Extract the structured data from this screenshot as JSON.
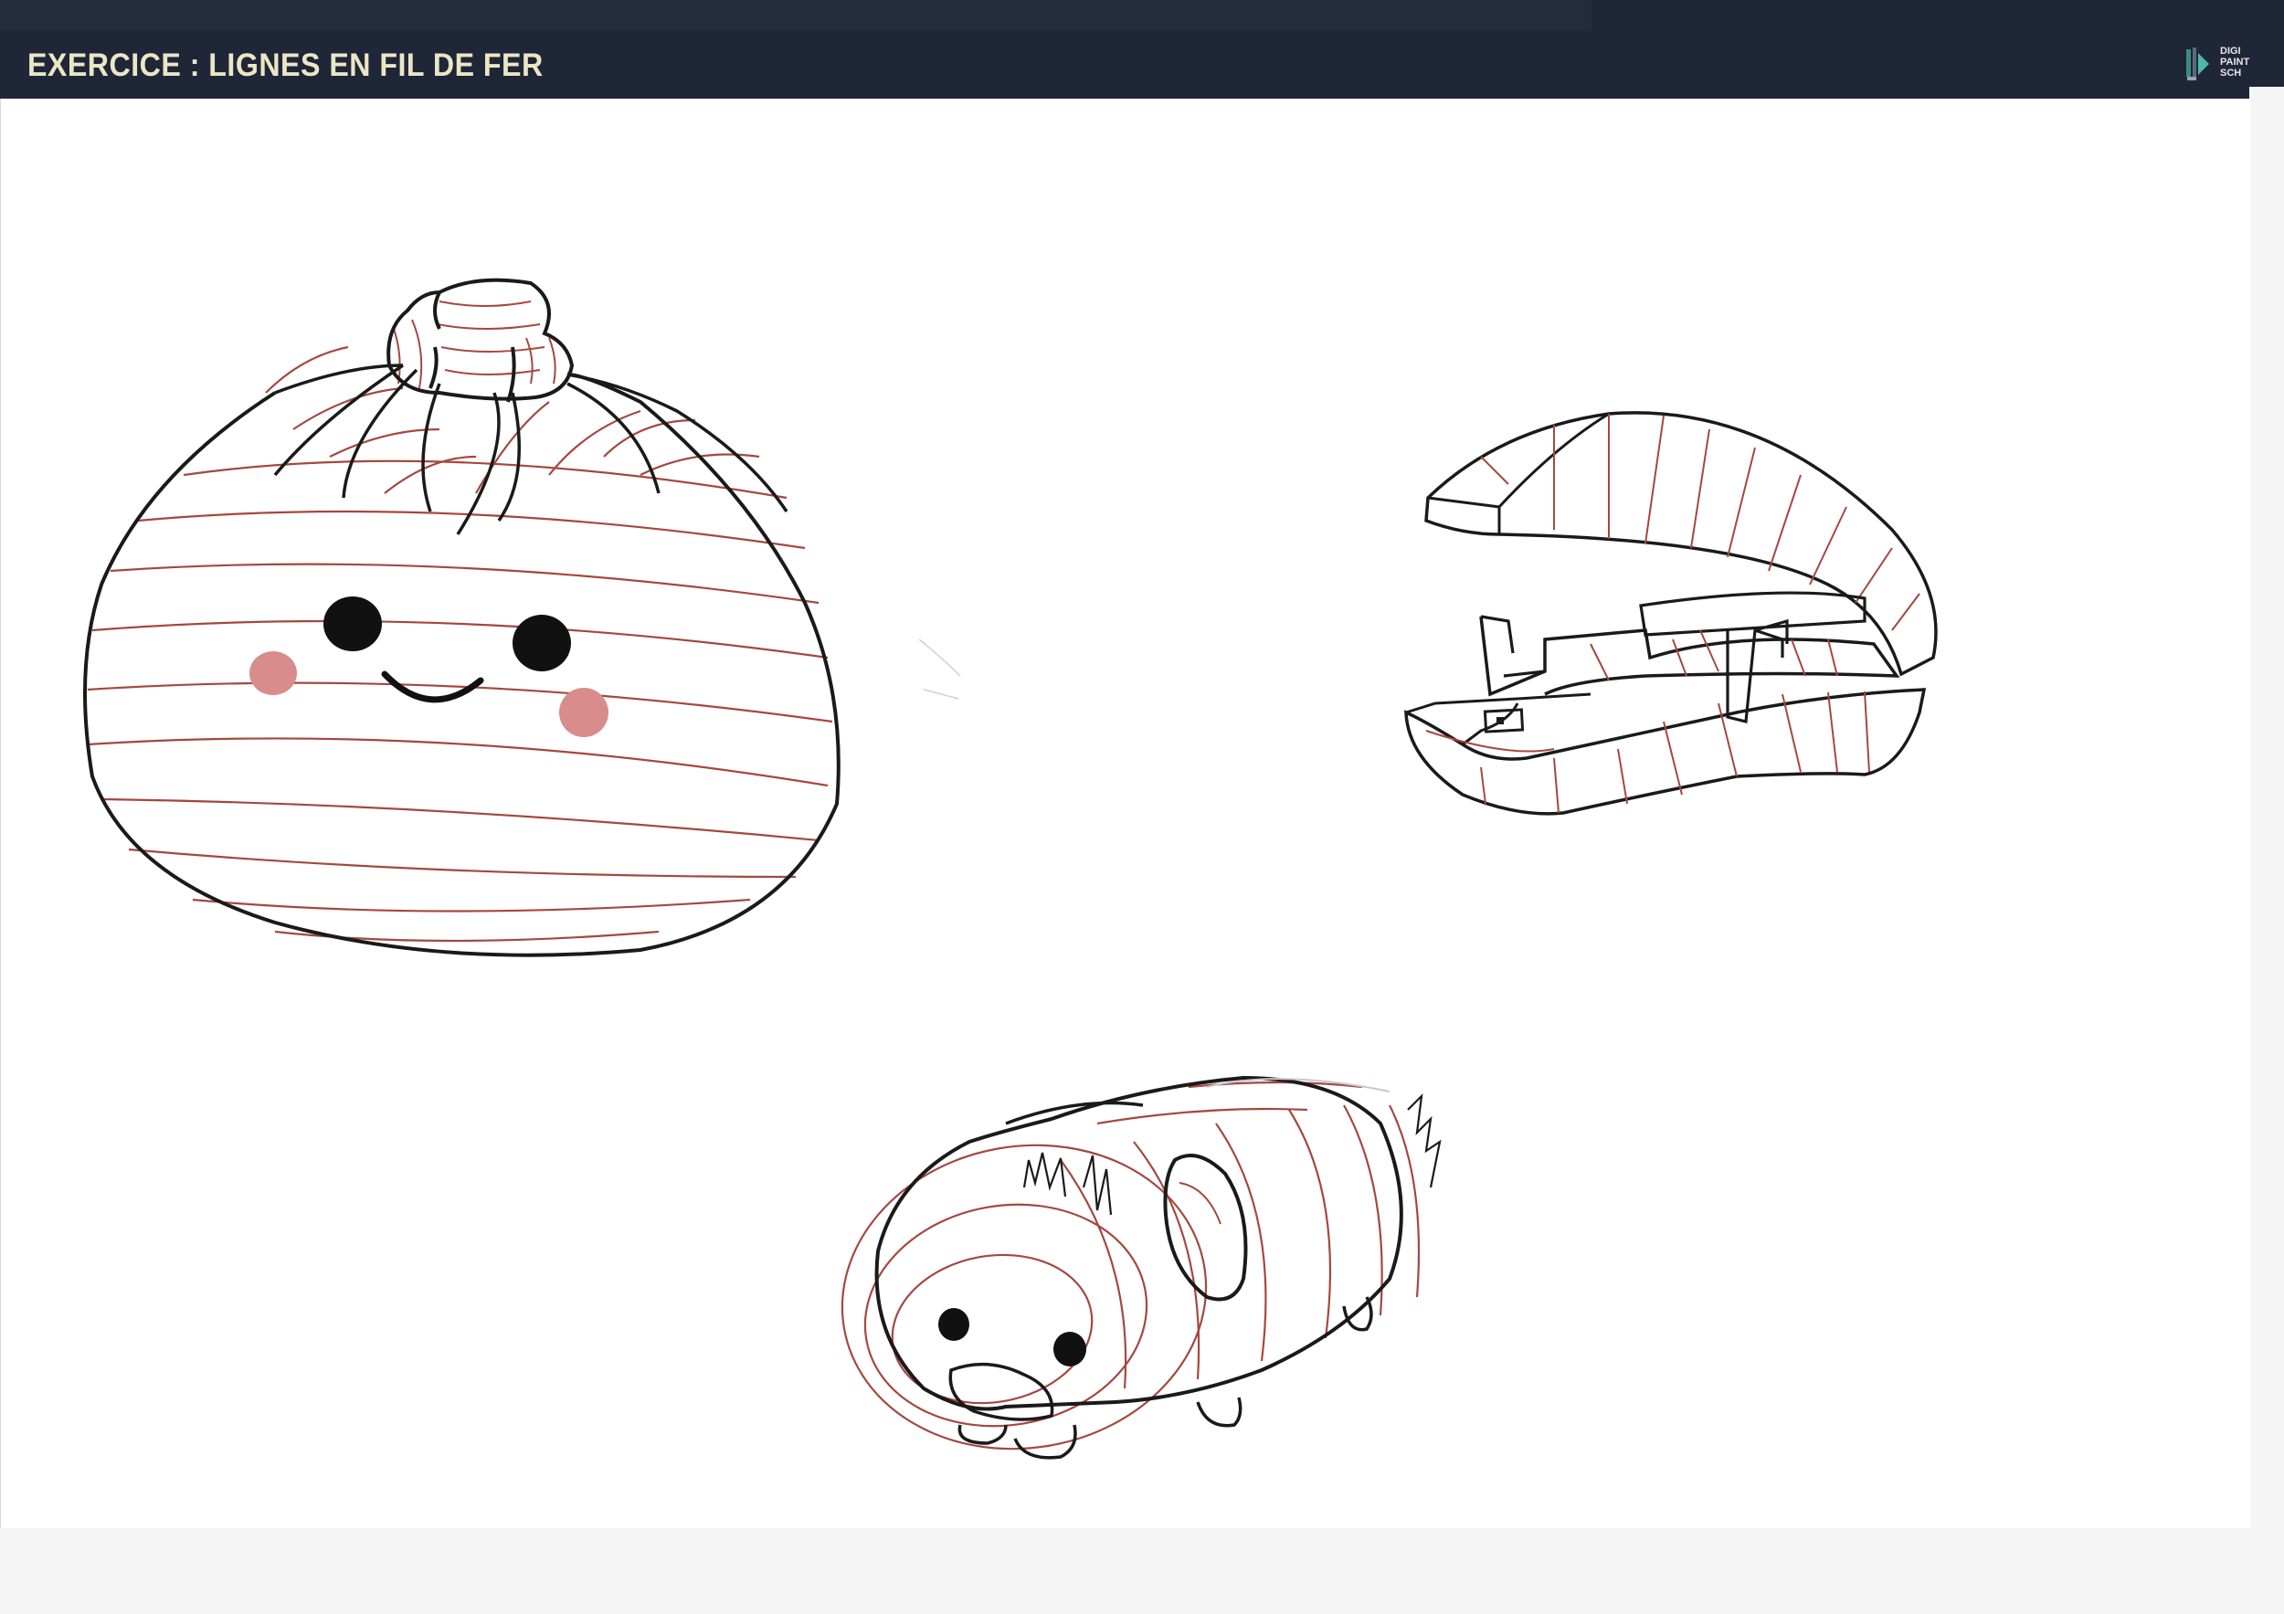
{
  "header": {
    "title": "EXERCICE : LIGNES EN FIL DE FER",
    "logo_text": "DIGI\nPAINT\nSCH",
    "logo_icon": "pencil-brush-icon"
  },
  "colors": {
    "header_bg": "#1f2638",
    "title_text": "#ece6c5",
    "outline": "#1a1a1a",
    "wireframe": "#a4483f",
    "blush": "#d98c8c"
  },
  "drawings": [
    "bun-character-drawing",
    "stapler-drawing",
    "guinea-pig-drawing"
  ]
}
